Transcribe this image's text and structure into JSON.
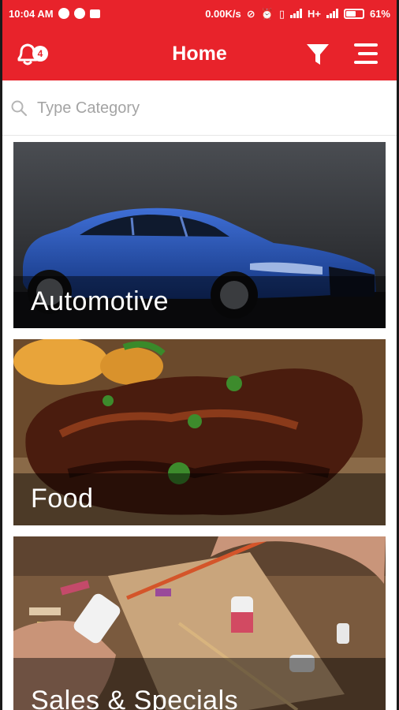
{
  "status_bar": {
    "time": "10:04 AM",
    "network_speed": "0.00K/s",
    "network_type": "H+",
    "battery_percent": "61%",
    "battery_level": 0.61
  },
  "app_bar": {
    "title": "Home",
    "notification_count": "4",
    "icons": [
      "bell-icon",
      "filter-icon",
      "menu-icon"
    ],
    "color": "#e8232b"
  },
  "search": {
    "placeholder": "Type Category",
    "value": ""
  },
  "categories": [
    {
      "label": "Automotive"
    },
    {
      "label": "Food"
    },
    {
      "label": "Sales & Specials"
    }
  ]
}
